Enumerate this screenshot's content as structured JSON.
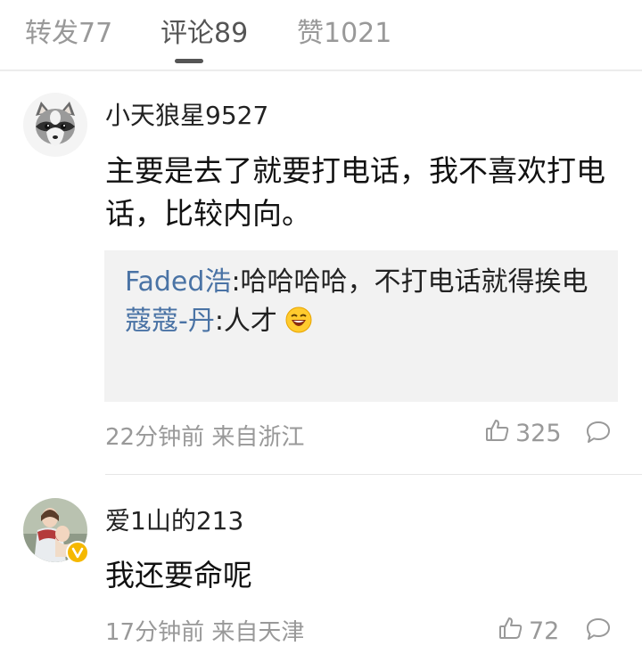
{
  "tabs": [
    {
      "label": "转发77"
    },
    {
      "label": "评论89"
    },
    {
      "label": "赞1021"
    }
  ],
  "active_tab": 1,
  "comments": [
    {
      "username": "小天狼星9527",
      "content": "主要是去了就要打电话，我不喜欢打电话，比较内向。",
      "replies": [
        {
          "user": "Faded浩",
          "text": ":哈哈哈哈，不打电话就得挨电"
        },
        {
          "user": "蔻蔻-丹",
          "text": ":人才"
        }
      ],
      "time_location": "22分钟前 来自浙江",
      "likes": "325",
      "avatar_icon": "raccoon-avatar-icon"
    },
    {
      "username": "爱1山的213",
      "content": "我还要命呢",
      "time_location": "17分钟前 来自天津",
      "likes": "72",
      "avatar_icon": "madonna-painting-avatar-icon",
      "verified_badge_color": "#f5b800"
    }
  ],
  "colors": {
    "reply_username": "#4a73a5",
    "meta_text": "#999999",
    "reply_bg": "#f2f2f2"
  }
}
